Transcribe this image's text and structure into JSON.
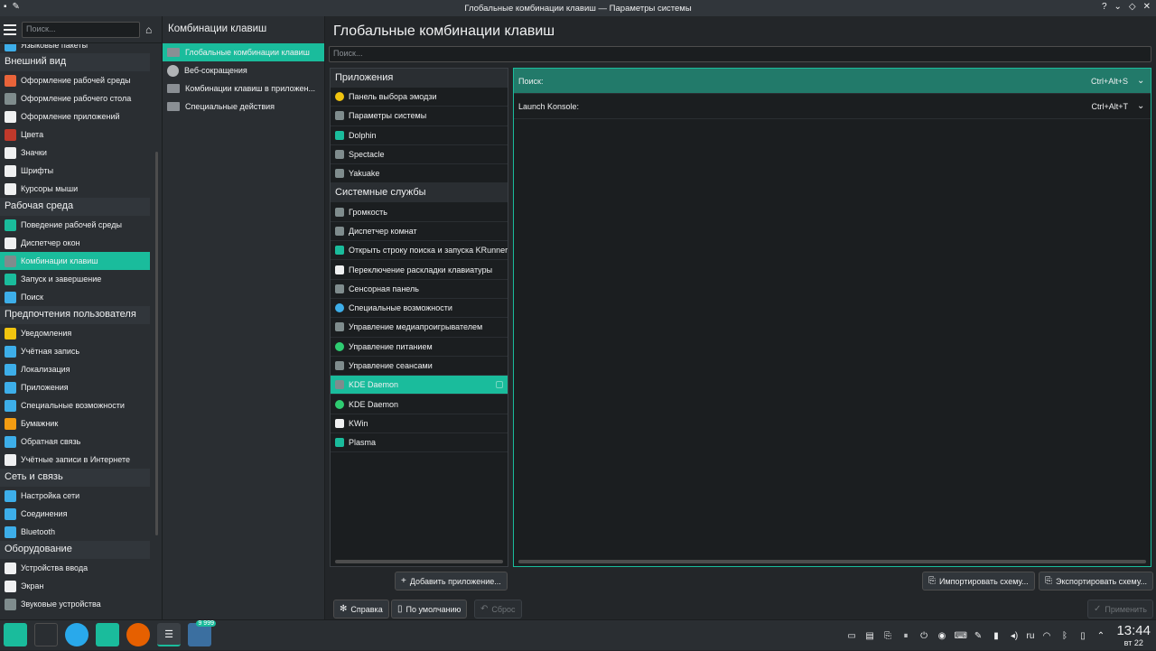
{
  "window": {
    "title": "Глобальные комбинации клавиш — Параметры системы",
    "controls": [
      "?",
      "⌄",
      "◇",
      "✕"
    ]
  },
  "sidebar": {
    "search_placeholder": "Поиск...",
    "partial_top": "Языковые пакеты",
    "sections": [
      {
        "title": "Внешний вид",
        "items": [
          {
            "label": "Оформление рабочей среды",
            "icon": "theme-icon",
            "color": "#e9643a"
          },
          {
            "label": "Оформление рабочего стола",
            "icon": "desktop-theme-icon",
            "color": "#7f8c8d"
          },
          {
            "label": "Оформление приложений",
            "icon": "app-style-icon",
            "color": "#eff0f1"
          },
          {
            "label": "Цвета",
            "icon": "colors-icon",
            "color": "#c0392b"
          },
          {
            "label": "Значки",
            "icon": "icons-icon",
            "color": "#eff0f1"
          },
          {
            "label": "Шрифты",
            "icon": "fonts-icon",
            "color": "#eff0f1"
          },
          {
            "label": "Курсоры мыши",
            "icon": "cursor-icon",
            "color": "#eff0f1"
          }
        ]
      },
      {
        "title": "Рабочая среда",
        "items": [
          {
            "label": "Поведение рабочей среды",
            "icon": "workspace-icon",
            "color": "#1abc9c"
          },
          {
            "label": "Диспетчер окон",
            "icon": "window-manager-icon",
            "color": "#eff0f1"
          },
          {
            "label": "Комбинации клавиш",
            "icon": "keyboard-icon",
            "color": "#7f8c8d",
            "active": true
          },
          {
            "label": "Запуск и завершение",
            "icon": "startup-icon",
            "color": "#1abc9c"
          },
          {
            "label": "Поиск",
            "icon": "search-icon",
            "color": "#3daee9"
          }
        ]
      },
      {
        "title": "Предпочтения пользователя",
        "items": [
          {
            "label": "Уведомления",
            "icon": "bell-icon",
            "color": "#f1c40f"
          },
          {
            "label": "Учётная запись",
            "icon": "user-icon",
            "color": "#3daee9"
          },
          {
            "label": "Локализация",
            "icon": "locale-icon",
            "color": "#3daee9"
          },
          {
            "label": "Приложения",
            "icon": "apps-icon",
            "color": "#3daee9"
          },
          {
            "label": "Специальные возможности",
            "icon": "accessibility-icon",
            "color": "#3daee9"
          },
          {
            "label": "Бумажник",
            "icon": "wallet-icon",
            "color": "#f39c12"
          },
          {
            "label": "Обратная связь",
            "icon": "feedback-icon",
            "color": "#3daee9"
          },
          {
            "label": "Учётные записи в Интернете",
            "icon": "online-accounts-icon",
            "color": "#eff0f1"
          }
        ]
      },
      {
        "title": "Сеть и связь",
        "items": [
          {
            "label": "Настройка сети",
            "icon": "network-icon",
            "color": "#3daee9"
          },
          {
            "label": "Соединения",
            "icon": "connections-icon",
            "color": "#3daee9"
          },
          {
            "label": "Bluetooth",
            "icon": "bluetooth-icon",
            "color": "#3daee9"
          }
        ]
      },
      {
        "title": "Оборудование",
        "items": [
          {
            "label": "Устройства ввода",
            "icon": "input-devices-icon",
            "color": "#eff0f1"
          },
          {
            "label": "Экран",
            "icon": "display-icon",
            "color": "#eff0f1"
          },
          {
            "label": "Звуковые устройства",
            "icon": "audio-icon",
            "color": "#7f8c8d"
          }
        ]
      }
    ]
  },
  "subcategories": {
    "title": "Комбинации клавиш",
    "items": [
      {
        "label": "Глобальные комбинации клавиш",
        "active": true,
        "icon": "keyboard-icon"
      },
      {
        "label": "Веб-сокращения",
        "active": false,
        "icon": "globe-icon"
      },
      {
        "label": "Комбинации клавиш в приложен...",
        "active": false,
        "icon": "keyboard-icon"
      },
      {
        "label": "Специальные действия",
        "active": false,
        "icon": "keyboard-icon"
      }
    ]
  },
  "main": {
    "title": "Глобальные комбинации клавиш",
    "search_placeholder": "Поиск...",
    "app_sections": [
      {
        "title": "Приложения",
        "items": [
          {
            "label": "Панель выбора эмодзи",
            "icon": "emoji-icon",
            "color": "#f1c40f"
          },
          {
            "label": "Параметры системы",
            "icon": "settings-icon",
            "color": "#7f8c8d"
          },
          {
            "label": "Dolphin",
            "icon": "folder-icon",
            "color": "#1abc9c"
          },
          {
            "label": "Spectacle",
            "icon": "screenshot-icon",
            "color": "#7f8c8d"
          },
          {
            "label": "Yakuake",
            "icon": "terminal-icon",
            "color": "#7f8c8d"
          }
        ]
      },
      {
        "title": "Системные службы",
        "items": [
          {
            "label": "Громкость",
            "icon": "volume-icon",
            "color": "#7f8c8d"
          },
          {
            "label": "Диспетчер комнат",
            "icon": "activities-icon",
            "color": "#7f8c8d"
          },
          {
            "label": "Открыть строку поиска и запуска KRunner",
            "icon": "krunner-icon",
            "color": "#1abc9c"
          },
          {
            "label": "Переключение раскладки клавиатуры",
            "icon": "keyboard-layout-icon",
            "color": "#eff0f1"
          },
          {
            "label": "Сенсорная панель",
            "icon": "touchpad-icon",
            "color": "#7f8c8d"
          },
          {
            "label": "Специальные возможности",
            "icon": "accessibility-icon",
            "color": "#3daee9"
          },
          {
            "label": "Управление медиапроигрывателем",
            "icon": "media-icon",
            "color": "#7f8c8d"
          },
          {
            "label": "Управление питанием",
            "icon": "power-icon",
            "color": "#2ecc71"
          },
          {
            "label": "Управление сеансами",
            "icon": "session-icon",
            "color": "#7f8c8d"
          },
          {
            "label": "KDE Daemon",
            "icon": "kded-icon",
            "color": "#7f8c8d",
            "active": true
          },
          {
            "label": "KDE Daemon",
            "icon": "kded-power-icon",
            "color": "#2ecc71"
          },
          {
            "label": "KWin",
            "icon": "kwin-icon",
            "color": "#eff0f1"
          },
          {
            "label": "Plasma",
            "icon": "plasma-icon",
            "color": "#1abc9c"
          }
        ]
      }
    ],
    "shortcuts": [
      {
        "name": "Поиск:",
        "key": "Ctrl+Alt+S",
        "active": true
      },
      {
        "name": "Launch Konsole:",
        "key": "Ctrl+Alt+T",
        "active": false
      }
    ],
    "buttons": {
      "add_app": "Добавить приложение...",
      "import": "Импортировать схему...",
      "export": "Экспортировать схему...",
      "help": "Справка",
      "defaults": "По умолчанию",
      "reset": "Сброс",
      "apply": "Применить"
    }
  },
  "taskbar": {
    "badge": "9 999",
    "tray": {
      "language": "ru"
    },
    "clock": {
      "time": "13:44",
      "date": "вт 22"
    }
  }
}
